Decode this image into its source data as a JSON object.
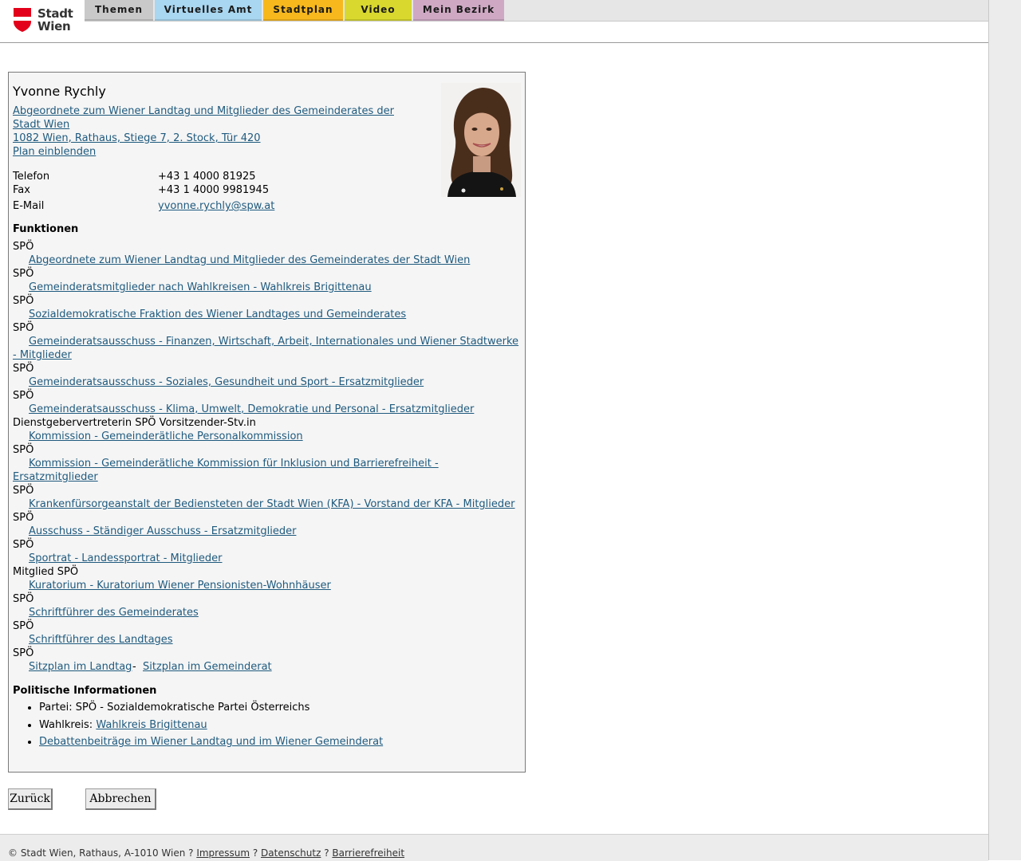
{
  "colors": {
    "tab_themen": "#c9c9c9",
    "tab_virtuelles_amt": "#a9d6f0",
    "tab_stadtplan": "#f6b81d",
    "tab_video": "#d8d82e",
    "tab_mein_bezirk": "#cfa9c4",
    "link": "#1f5a7e",
    "logo_red": "#e2001a"
  },
  "logo": {
    "line1": "Stadt",
    "line2": "Wien"
  },
  "nav": {
    "tabs": [
      "Themen",
      "Virtuelles Amt",
      "Stadtplan",
      "Video",
      "Mein Bezirk"
    ]
  },
  "person": {
    "name": "Yvonne Rychly",
    "role_line1": "Abgeordnete zum Wiener Landtag und Mitglieder des Gemeinderates der",
    "role_line2": "Stadt Wien ",
    "address": "1082 Wien, Rathaus, Stiege 7, 2. Stock, Tür 420",
    "plan_link": "Plan einblenden",
    "contact": [
      {
        "label": "Telefon",
        "value": "+43 1 4000 81925"
      },
      {
        "label": "Fax",
        "value": "+43 1 4000 9981945"
      },
      {
        "label": "E-Mail",
        "value": "yvonne.rychly@spw.at"
      }
    ]
  },
  "functions": {
    "heading": "Funktionen",
    "items": [
      {
        "role": "SPÖ",
        "link1": "Abgeordnete zum Wiener Landtag und Mitglieder des Gemeinderates der Stadt Wien"
      },
      {
        "role": "SPÖ",
        "link1": "Gemeinderatsmitglieder nach Wahlkreisen - Wahlkreis Brigittenau"
      },
      {
        "role": "SPÖ",
        "link1": "Sozialdemokratische Fraktion des Wiener Landtages und Gemeinderates"
      },
      {
        "role": "SPÖ",
        "link1": "Gemeinderatsausschuss - Finanzen, Wirtschaft, Arbeit, Internationales und Wiener Stadtwerke",
        "link2": "- Mitglieder"
      },
      {
        "role": "SPÖ",
        "link1": "Gemeinderatsausschuss - Soziales, Gesundheit und Sport - Ersatzmitglieder"
      },
      {
        "role": "SPÖ",
        "link1": "Gemeinderatsausschuss - Klima, Umwelt, Demokratie und Personal - Ersatzmitglieder"
      },
      {
        "role": "Dienstgebervertreterin SPÖ Vorsitzender-Stv.in",
        "link1": "Kommission - Gemeinderätliche Personalkommission"
      },
      {
        "role": "SPÖ",
        "link1": "Kommission - Gemeinderätliche Kommission für Inklusion und Barrierefreiheit -",
        "link2": "Ersatzmitglieder"
      },
      {
        "role": "SPÖ",
        "link1": "Krankenfürsorgeanstalt der Bediensteten der Stadt Wien (KFA) - Vorstand der KFA - Mitglieder"
      },
      {
        "role": "SPÖ",
        "link1": "Ausschuss - Ständiger Ausschuss - Ersatzmitglieder"
      },
      {
        "role": "SPÖ",
        "link1": "Sportrat - Landessportrat - Mitglieder"
      },
      {
        "role": "Mitglied SPÖ",
        "link1": "Kuratorium - Kuratorium Wiener Pensionisten-Wohnhäuser"
      },
      {
        "role": "SPÖ",
        "link1": "Schriftführer des Gemeinderates"
      },
      {
        "role": "SPÖ",
        "link1": "Schriftführer des Landtages"
      },
      {
        "role": "SPÖ",
        "link1": "Sitzplan im Landtag",
        "sep": " - ",
        "link3": "Sitzplan im Gemeinderat"
      }
    ]
  },
  "political": {
    "heading": "Politische Informationen",
    "party": "Partei: SPÖ - Sozialdemokratische Partei Österreichs",
    "district_label": "Wahlkreis: ",
    "district_link": "Wahlkreis Brigittenau",
    "debates_link": "Debattenbeiträge im Wiener Landtag und im Wiener Gemeinderat"
  },
  "buttons": {
    "back": "Zurück",
    "cancel": "Abbrechen"
  },
  "footer": {
    "copyright": "© Stadt Wien, Rathaus, A-1010 Wien ? ",
    "impressum": "Impressum",
    "sep": " ? ",
    "datenschutz": "Datenschutz",
    "barrierefreiheit": "Barrierefreiheit"
  }
}
